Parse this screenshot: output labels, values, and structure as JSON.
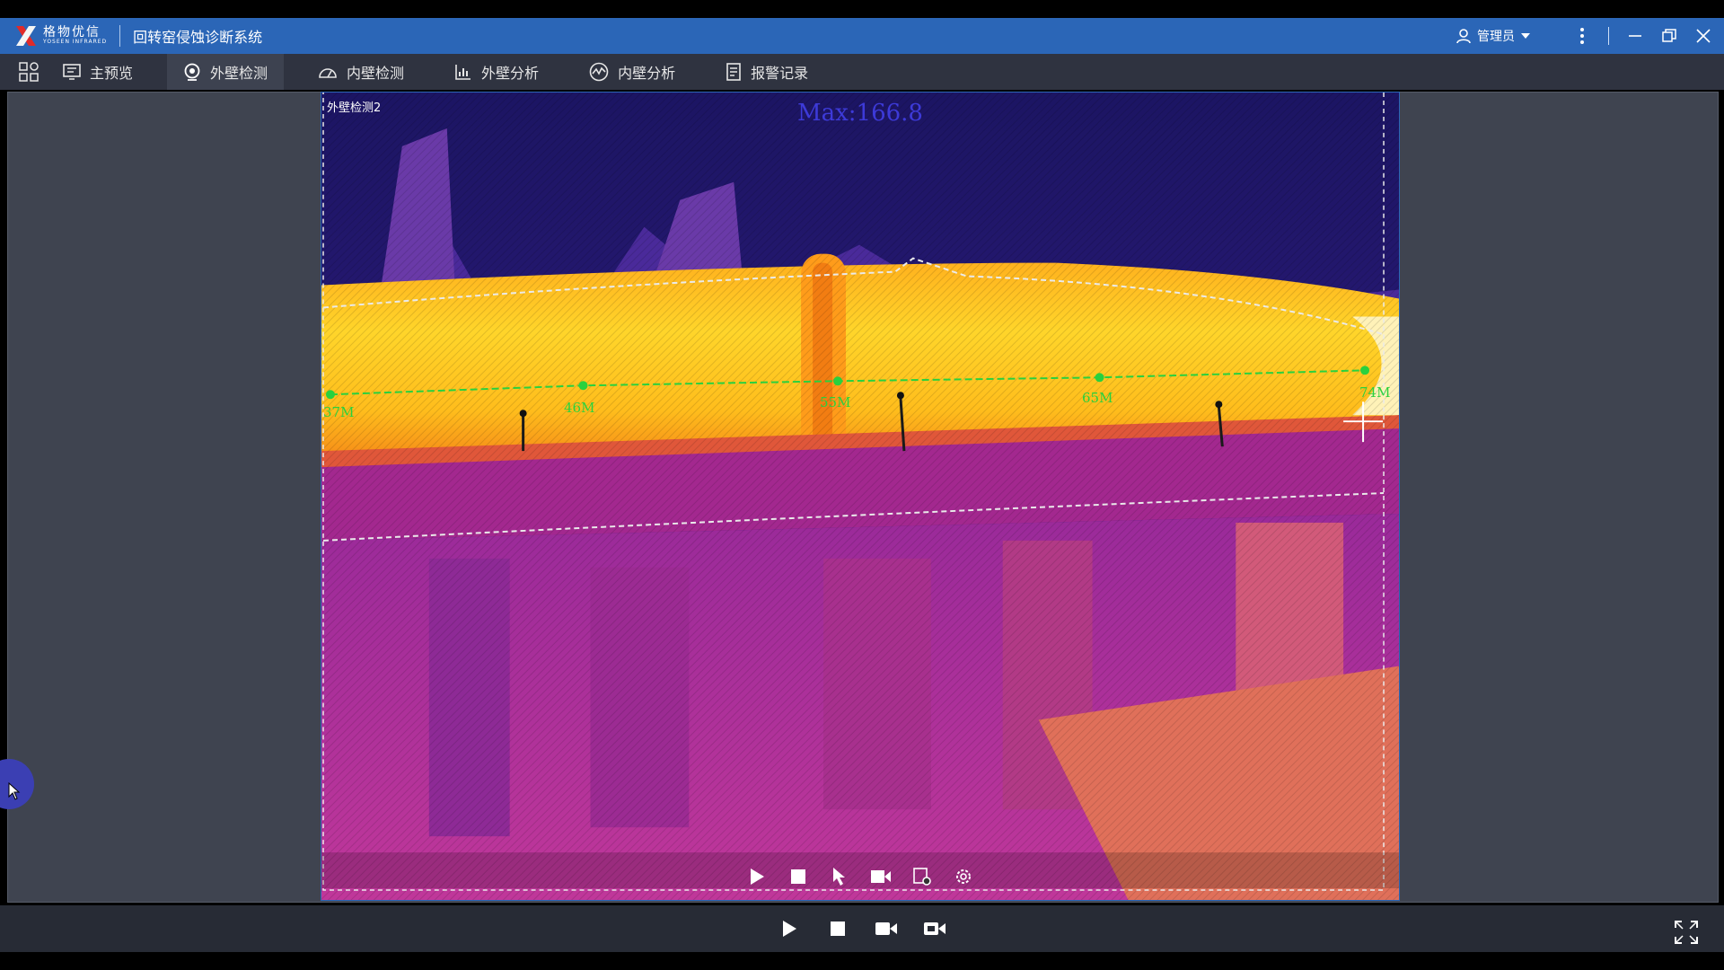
{
  "header": {
    "logo_cn": "格物优信",
    "logo_en": "YOSEEN INFRARED",
    "app_title": "回转窑侵蚀诊断系统",
    "user_label": "管理员"
  },
  "nav": {
    "tabs": [
      {
        "label": "主预览",
        "icon": "monitor-icon"
      },
      {
        "label": "外壁检测",
        "icon": "camera-icon"
      },
      {
        "label": "内壁检测",
        "icon": "gauge-icon"
      },
      {
        "label": "外壁分析",
        "icon": "chart-icon"
      },
      {
        "label": "内壁分析",
        "icon": "wave-icon"
      },
      {
        "label": "报警记录",
        "icon": "document-icon"
      }
    ],
    "active_index": 1
  },
  "viewer": {
    "label": "外壁检测2",
    "max_text": "Max:166.8",
    "markers": [
      "37M",
      "46M",
      "55M",
      "65M",
      "74M"
    ],
    "controls": [
      "play-icon",
      "stop-icon",
      "pointer-icon",
      "record-icon",
      "snapshot-settings-icon",
      "gear-icon"
    ]
  },
  "footer": {
    "controls": [
      "play-icon",
      "stop-icon",
      "camera-icon",
      "video-icon",
      "fullscreen-icon"
    ]
  },
  "colors": {
    "titlebar": "#2b66b7",
    "menubar": "#2f3340",
    "panel": "#3f4450",
    "marker_line": "#29d13e",
    "max_text": "#3d3ad8"
  }
}
